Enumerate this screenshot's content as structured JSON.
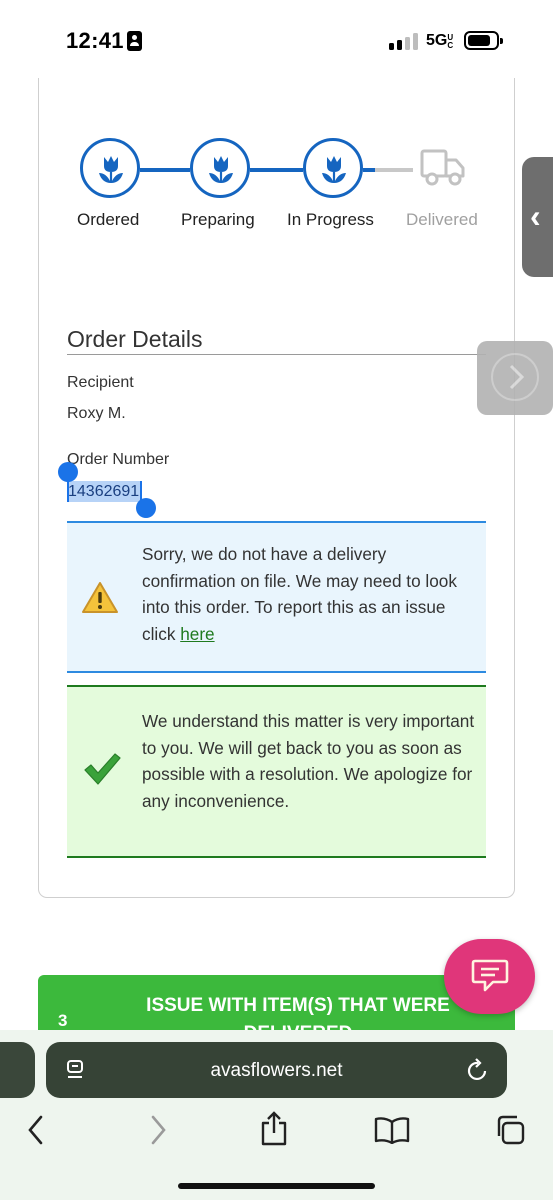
{
  "status_bar": {
    "time": "12:41",
    "network": "5G",
    "network_suffix": "UC",
    "icons": [
      "id-card-icon",
      "signal-icon",
      "battery-icon"
    ]
  },
  "tracker": {
    "steps": [
      {
        "label": "Ordered",
        "state": "complete",
        "icon": "flower-icon"
      },
      {
        "label": "Preparing",
        "state": "complete",
        "icon": "flower-icon"
      },
      {
        "label": "In Progress",
        "state": "complete",
        "icon": "flower-icon"
      },
      {
        "label": "Delivered",
        "state": "pending",
        "icon": "truck-icon"
      }
    ],
    "colors": {
      "active": "#1565c0",
      "inactive": "#c8c8c8"
    }
  },
  "order_details": {
    "title": "Order Details",
    "recipient_label": "Recipient",
    "recipient_value": "Roxy M.",
    "order_number_label": "Order Number",
    "order_number_value": "14362691"
  },
  "alerts": {
    "warning": {
      "icon": "warning-icon",
      "text": "Sorry, we do not have a delivery confirmation on file. We may need to look into this order. To report this as an issue click ",
      "link_text": "here"
    },
    "success": {
      "icon": "checkmark-icon",
      "text": "We understand this matter is very important to you. We will get back to you as soon as possible with a resolution. We apologize for any inconvenience."
    }
  },
  "issue_button": {
    "number": "3",
    "label": "ISSUE WITH ITEM(S) THAT WERE DELIVERED"
  },
  "chat_button": {
    "icon": "chat-icon",
    "color": "#e0367a"
  },
  "side_controls": {
    "tab_icon": "chevron-left-icon",
    "next_icon": "chevron-right-icon"
  },
  "browser": {
    "url": "avasflowers.net",
    "nav_icons": [
      "back-icon",
      "forward-icon",
      "share-icon",
      "bookmarks-icon",
      "tabs-icon"
    ]
  }
}
